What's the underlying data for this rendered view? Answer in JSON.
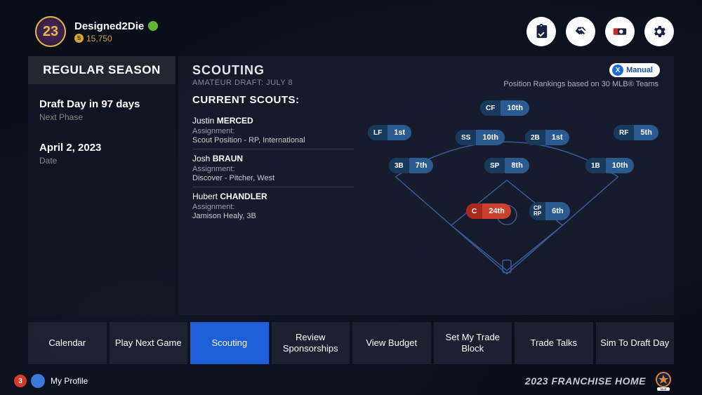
{
  "header": {
    "player_number": "23",
    "player_name": "Designed2Die",
    "currency": "15,750"
  },
  "side": {
    "title": "REGULAR SEASON",
    "draft_main": "Draft Day in 97 days",
    "draft_sub": "Next Phase",
    "date_main": "April 2, 2023",
    "date_sub": "Date"
  },
  "main": {
    "title": "SCOUTING",
    "subtitle": "AMATEUR DRAFT: JULY 8",
    "manual_label": "Manual",
    "rankings_note": "Position Rankings based on 30 MLB® Teams",
    "scouts_title": "CURRENT SCOUTS:",
    "scouts": [
      {
        "first": "Justin",
        "last": "MERCED",
        "label": "Assignment:",
        "assign": "Scout Position - RP, International"
      },
      {
        "first": "Josh",
        "last": "BRAUN",
        "label": "Assignment:",
        "assign": "Discover - Pitcher, West"
      },
      {
        "first": "Hubert",
        "last": "CHANDLER",
        "label": "Assignment:",
        "assign": "Jamison Healy, 3B"
      }
    ],
    "positions": {
      "cf": {
        "label": "CF",
        "rank": "10th"
      },
      "lf": {
        "label": "LF",
        "rank": "1st"
      },
      "ss": {
        "label": "SS",
        "rank": "10th"
      },
      "2b": {
        "label": "2B",
        "rank": "1st"
      },
      "rf": {
        "label": "RF",
        "rank": "5th"
      },
      "3b": {
        "label": "3B",
        "rank": "7th"
      },
      "sp": {
        "label": "SP",
        "rank": "8th"
      },
      "1b": {
        "label": "1B",
        "rank": "10th"
      },
      "c": {
        "label": "C",
        "rank": "24th"
      },
      "cprp": {
        "label": "CP\nRP",
        "rank": "6th"
      }
    }
  },
  "nav": {
    "items": [
      "Calendar",
      "Play Next Game",
      "Scouting",
      "Review Sponsorships",
      "View Budget",
      "Set My Trade Block",
      "Trade Talks",
      "Sim To Draft Day"
    ]
  },
  "footer": {
    "badge_count": "3",
    "profile": "My Profile",
    "title": "2023 FRANCHISE HOME"
  }
}
